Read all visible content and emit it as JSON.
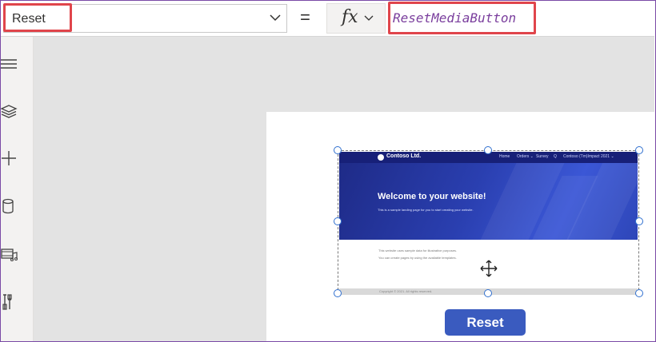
{
  "formula_bar": {
    "property_value": "Reset",
    "equals": "=",
    "fx_label": "fx",
    "formula": "ResetMediaButton"
  },
  "left_rail": {
    "icons": [
      "menu-icon",
      "layers-icon",
      "add-icon",
      "data-icon",
      "media-icon",
      "tools-icon"
    ]
  },
  "media_preview": {
    "brand": "Contoso Ltd.",
    "nav": [
      "Home",
      "Orders ⌄",
      "Survey",
      "Q",
      "Contoso (Tm)Impact 2021 ⌄"
    ],
    "hero_title": "Welcome to your website!",
    "hero_subtitle": "This is a sample landing page for you to start creating your website.",
    "body_line_1": "This website uses sample data for illustrative purposes.",
    "body_line_2": "You can create pages by using the available templates.",
    "footer": "Copyright © 2021. All rights reserved."
  },
  "reset_button": {
    "label": "Reset"
  },
  "colors": {
    "highlight": "#e0454b",
    "formula_text": "#7a3e9d",
    "button_bg": "#3a5bbf",
    "selection": "#2f6fcf"
  }
}
